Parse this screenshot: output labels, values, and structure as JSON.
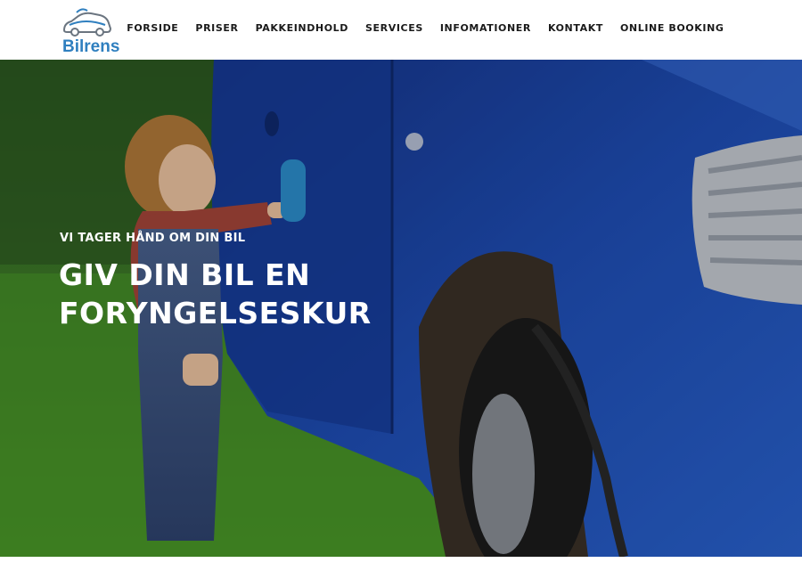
{
  "brand": {
    "name": "Bilrens",
    "color": "#2f7fbf"
  },
  "nav": {
    "items": [
      {
        "label": "FORSIDE"
      },
      {
        "label": "PRISER"
      },
      {
        "label": "PAKKEINDHOLD"
      },
      {
        "label": "SERVICES"
      },
      {
        "label": "INFOMATIONER"
      },
      {
        "label": "KONTAKT"
      },
      {
        "label": "ONLINE BOOKING"
      }
    ]
  },
  "hero": {
    "subtitle": "VI TAGER HÅND OM DIN BIL",
    "title": "GIV DIN BIL EN FORYNGELSESKUR",
    "image": "child-washing-blue-car-photo",
    "car_color": "#1f4fb8",
    "grass_color": "#3f8a22"
  }
}
